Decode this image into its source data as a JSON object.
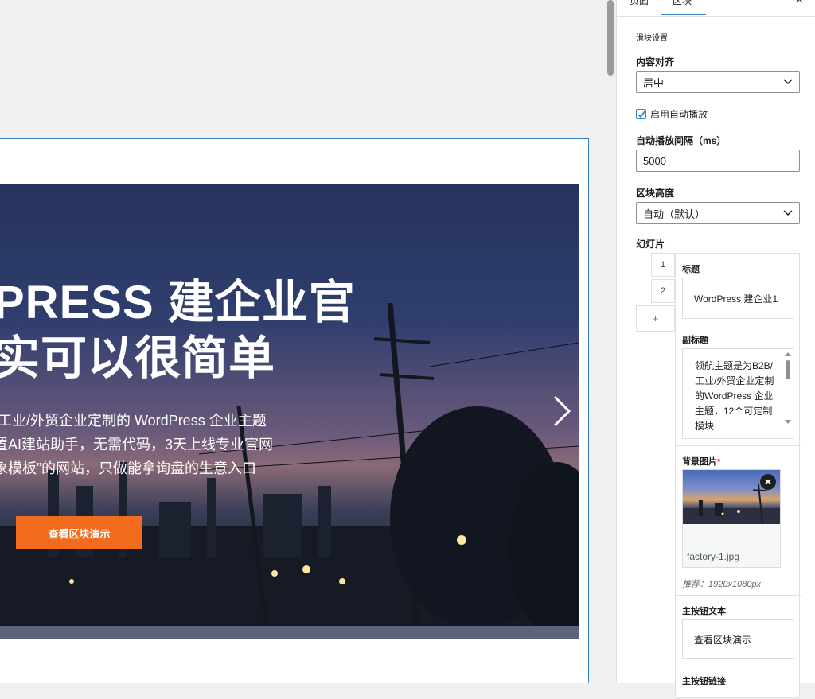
{
  "canvas": {
    "slide": {
      "title_line1": "PRESS 建企业官",
      "title_line2": "实可以很简单",
      "subtitle_line1": "/工业/外贸企业定制的 WordPress 企业主题",
      "subtitle_line2": "置AI建站助手，无需代码，3天上线专业官网",
      "subtitle_line3": "象模板”的网站，只做能拿询盘的生意入口",
      "button_label": "查看区块演示",
      "button_color": "#f36b1c",
      "next_icon": "chevron-right-icon"
    },
    "frame_color": "#3582c4"
  },
  "sidebar": {
    "tabs": [
      "页面",
      "区块"
    ],
    "section_title": "滑块设置",
    "align": {
      "label": "内容对齐",
      "value": "居中"
    },
    "autoplay": {
      "label": "启用自动播放",
      "checked": true
    },
    "interval": {
      "label": "自动播放间隔（ms）",
      "value": "5000"
    },
    "height": {
      "label": "区块高度",
      "value": "自动（默认）"
    },
    "slides": {
      "label": "幻灯片",
      "numbers": [
        "1",
        "2"
      ],
      "add_label": "+",
      "title_label": "标题",
      "title_value": "WordPress 建企业1",
      "subtitle_label": "副标题",
      "subtitle_value": "领航主题是为B2B/工业/外贸企业定制的WordPress 企业主题，12个可定制模块",
      "bg_label": "背景图片",
      "bg_required": "*",
      "bg_file": "factory-1.jpg",
      "bg_hint": "推荐：1920x1080px",
      "btn_text_label": "主按钮文本",
      "btn_text_value": "查看区块演示",
      "btn_link_label": "主按钮链接"
    }
  }
}
